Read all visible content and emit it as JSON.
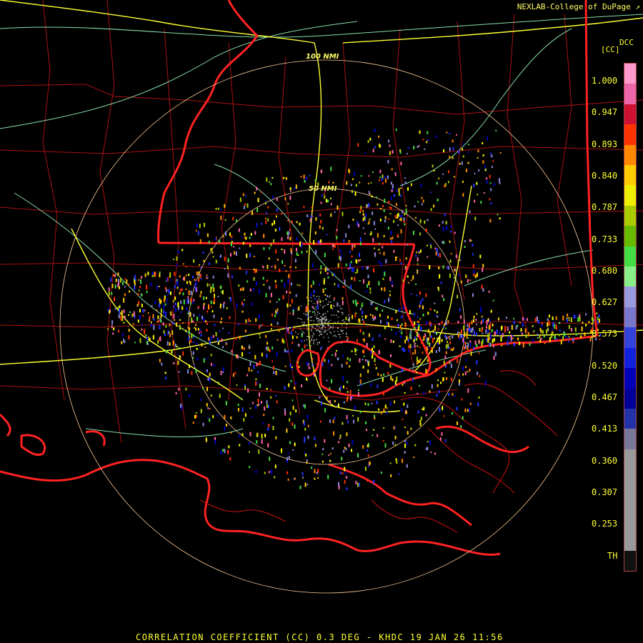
{
  "header": {
    "credit": "NEXLAB-College of DuPage"
  },
  "legend": {
    "product": "DCC",
    "units": "[CC]",
    "labels": [
      "1.000",
      "0.947",
      "0.893",
      "0.840",
      "0.787",
      "0.733",
      "0.680",
      "0.627",
      "0.573",
      "0.520",
      "0.467",
      "0.413",
      "0.360",
      "0.307",
      "0.253",
      "TH"
    ],
    "colors": [
      "#ff99cc",
      "#ee66aa",
      "#cc1133",
      "#ff3300",
      "#ff8800",
      "#ffcc00",
      "#eeee00",
      "#aacc00",
      "#66bb00",
      "#44dd44",
      "#88ee88",
      "#9999dd",
      "#7777cc",
      "#3344dd",
      "#1122dd",
      "#0000bb",
      "#000099",
      "#2233aa",
      "#777799",
      "#999999",
      "#999999",
      "#999999",
      "#999999",
      "#999999",
      "#111111"
    ]
  },
  "map": {
    "rings": [
      {
        "label": "100 NMI",
        "radius_nmi": 100
      },
      {
        "label": "50 NMI",
        "radius_nmi": 50
      }
    ],
    "colors": {
      "state_border": "#ff2222",
      "county_border": "#aa1111",
      "highway": "#ffff33",
      "road": "#88ddaa",
      "ring": "#ffcc99"
    }
  },
  "footer": {
    "caption": "CORRELATION COEFFICIENT (CC) 0.3 DEG - KHDC 19 JAN 26 11:56"
  }
}
